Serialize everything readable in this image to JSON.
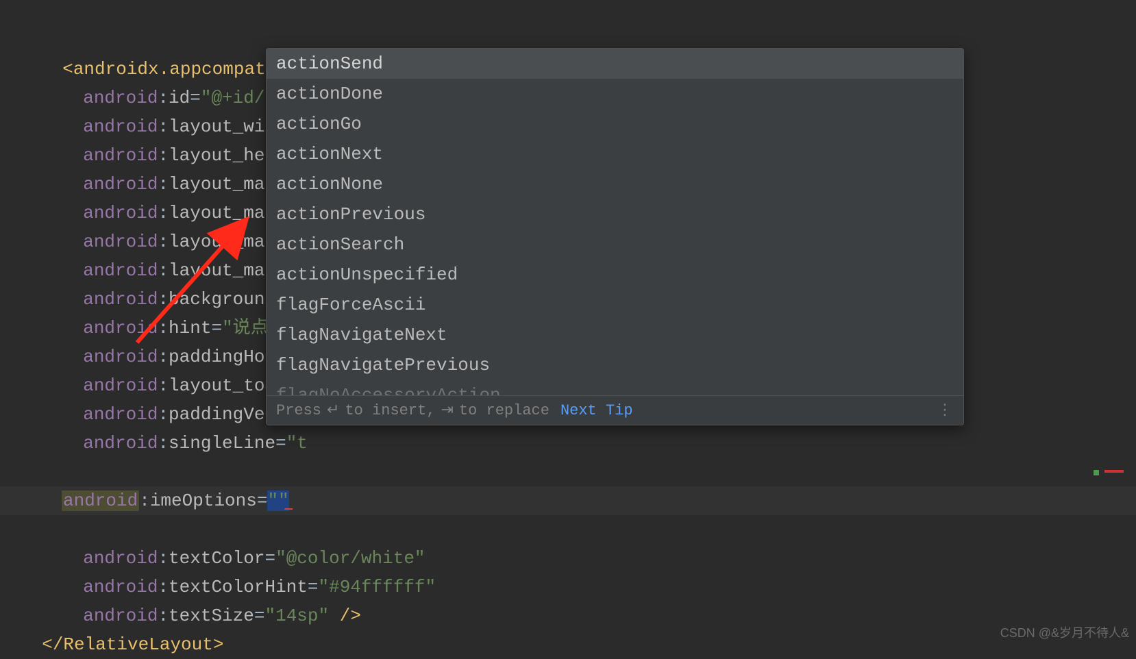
{
  "code": {
    "tag_open": "<androidx.appcompat.widget.AppCompatEditText",
    "attrs": [
      {
        "ns": "android",
        "name": "id",
        "value": "\"@+id/ch"
      },
      {
        "ns": "android",
        "name": "layout_width",
        "value": ""
      },
      {
        "ns": "android",
        "name": "layout_height",
        "value": ""
      },
      {
        "ns": "android",
        "name": "layout_margi",
        "value": ""
      },
      {
        "ns": "android",
        "name": "layout_margi",
        "value": ""
      },
      {
        "ns": "android",
        "name": "layout_margi",
        "value": ""
      },
      {
        "ns": "android",
        "name": "layout_margi",
        "value": ""
      },
      {
        "ns": "android",
        "name": "background",
        "value": ""
      },
      {
        "ns": "android",
        "name": "hint",
        "value": "\"说点什"
      },
      {
        "ns": "android",
        "name": "paddingHoriz",
        "value": ""
      },
      {
        "ns": "android",
        "name": "layout_toStar",
        "value": ""
      },
      {
        "ns": "android",
        "name": "paddingVerti",
        "value": ""
      },
      {
        "ns": "android",
        "name": "singleLine",
        "value": "\"t"
      }
    ],
    "cursor_line": {
      "ns": "android",
      "name": "imeOptions",
      "value": "\"\""
    },
    "after": [
      {
        "ns": "android",
        "name": "textColor",
        "value": "\"@color/white\""
      },
      {
        "ns": "android",
        "name": "textColorHint",
        "value": "\"#94ffffff\""
      },
      {
        "ns": "android",
        "name": "textSize",
        "value": "\"14sp\"",
        "close": " />"
      }
    ],
    "tag_close": "</RelativeLayout>"
  },
  "popup": {
    "items": [
      "actionSend",
      "actionDone",
      "actionGo",
      "actionNext",
      "actionNone",
      "actionPrevious",
      "actionSearch",
      "actionUnspecified",
      "flagForceAscii",
      "flagNavigateNext",
      "flagNavigatePrevious",
      "flagNoAccessoryAction"
    ],
    "selected_index": 0,
    "footer_press": "Press ",
    "footer_insert": " to insert, ",
    "footer_replace": " to replace",
    "footer_link": "Next Tip",
    "enter_glyph": "↵",
    "tab_glyph": "⇥"
  },
  "watermark": "CSDN @&岁月不待人&"
}
